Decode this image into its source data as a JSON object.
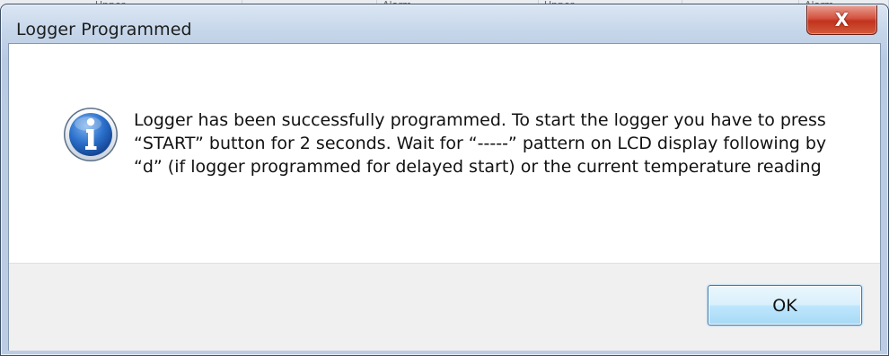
{
  "dialog": {
    "title": "Logger Programmed",
    "close_symbol": "X",
    "icon": "info-icon",
    "message": "Logger has been successfully programmed. To start the logger you have to press “START” button for 2 seconds. Wait for “-----” pattern on LCD display following by “d” (if logger programmed for delayed start) or the current temperature reading",
    "ok_label": "OK"
  },
  "background_window": {
    "cells": [
      "Upper",
      "",
      "Alarm",
      "Upper",
      "",
      "Alarm"
    ]
  },
  "colors": {
    "close_button": "#c1331d",
    "info_icon": "#1c5fb8",
    "ok_button_border": "#3c7fb1",
    "button_bar": "#f0f0f0"
  }
}
